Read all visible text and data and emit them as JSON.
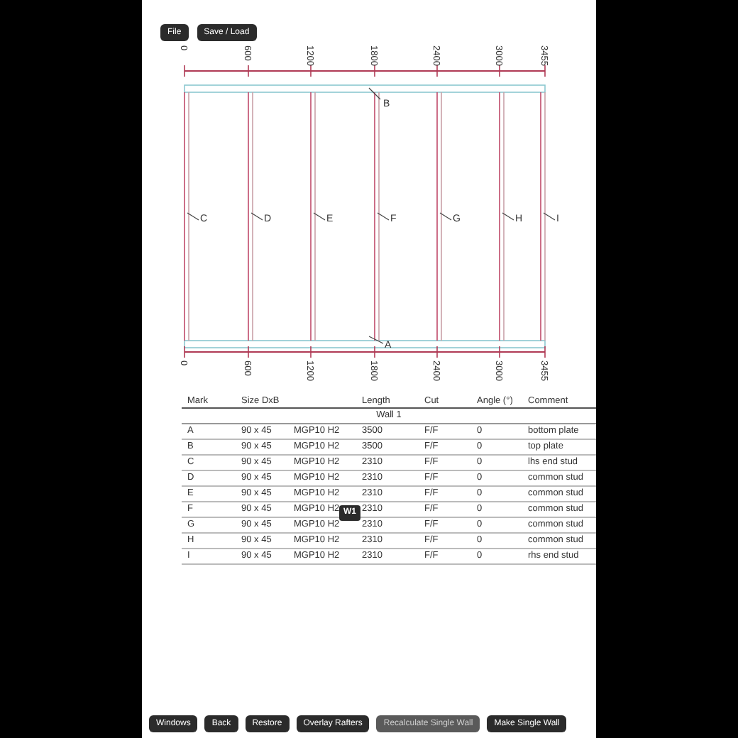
{
  "toolbar": [
    {
      "label": "File"
    },
    {
      "label": "Save / Load"
    }
  ],
  "drawing": {
    "top_ruler": [
      "0",
      "600",
      "1200",
      "1800",
      "2400",
      "3000",
      "3455"
    ],
    "top_plate_label": "B",
    "stud_labels": [
      "C",
      "D",
      "E",
      "F",
      "G",
      "H",
      "I"
    ],
    "bottom_plate_label": "A",
    "bottom_ruler": [
      "0",
      "600",
      "1200",
      "1800",
      "2400",
      "3000",
      "3455"
    ]
  },
  "table": {
    "columns": [
      "Mark",
      "Size DxB",
      "",
      "Length",
      "Cut",
      "Angle (°)",
      "Comment"
    ],
    "group": "Wall 1",
    "rows": [
      [
        "A",
        "90 x 45",
        "MGP10 H2",
        "3500",
        "F/F",
        "0",
        "bottom plate"
      ],
      [
        "B",
        "90 x 45",
        "MGP10 H2",
        "3500",
        "F/F",
        "0",
        "top plate"
      ],
      [
        "C",
        "90 x 45",
        "MGP10 H2",
        "2310",
        "F/F",
        "0",
        "lhs end stud"
      ],
      [
        "D",
        "90 x 45",
        "MGP10 H2",
        "2310",
        "F/F",
        "0",
        "common stud"
      ],
      [
        "E",
        "90 x 45",
        "MGP10 H2",
        "2310",
        "F/F",
        "0",
        "common stud"
      ],
      [
        "F",
        "90 x 45",
        "MGP10 H2",
        "2310",
        "F/F",
        "0",
        "common stud"
      ],
      [
        "G",
        "90 x 45",
        "MGP10 H2",
        "2310",
        "F/F",
        "0",
        "common stud"
      ],
      [
        "H",
        "90 x 45",
        "MGP10 H2",
        "2310",
        "F/F",
        "0",
        "common stud"
      ],
      [
        "I",
        "90 x 45",
        "MGP10 H2",
        "2310",
        "F/F",
        "0",
        "rhs end stud"
      ]
    ],
    "tooltip": "W1"
  },
  "bottom_buttons": [
    {
      "label": "Windows",
      "hovered": false
    },
    {
      "label": "Back",
      "hovered": false
    },
    {
      "label": "Restore",
      "hovered": false
    },
    {
      "label": "Overlay Rafters",
      "hovered": false
    },
    {
      "label": "Recalculate Single Wall",
      "hovered": true
    },
    {
      "label": "Make Single Wall",
      "hovered": false
    }
  ]
}
